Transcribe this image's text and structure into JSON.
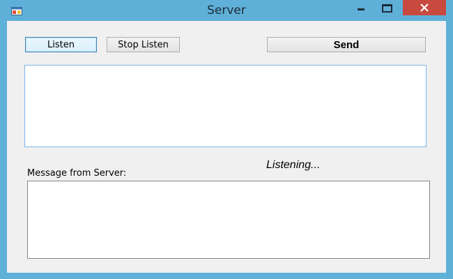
{
  "window": {
    "title": "Server",
    "app_icon": "application-icon",
    "controls": {
      "minimize_icon": "minimize-icon",
      "maximize_icon": "maximize-icon",
      "close_icon": "close-icon",
      "close_color": "#c84a3f"
    },
    "frame_color": "#5fb0d9"
  },
  "toolbar": {
    "listen_label": "Listen",
    "stop_listen_label": "Stop Listen",
    "send_label": "Send"
  },
  "send_textbox": {
    "value": ""
  },
  "status": {
    "text": "Listening..."
  },
  "messages": {
    "label": "Message from Server:",
    "value": ""
  }
}
